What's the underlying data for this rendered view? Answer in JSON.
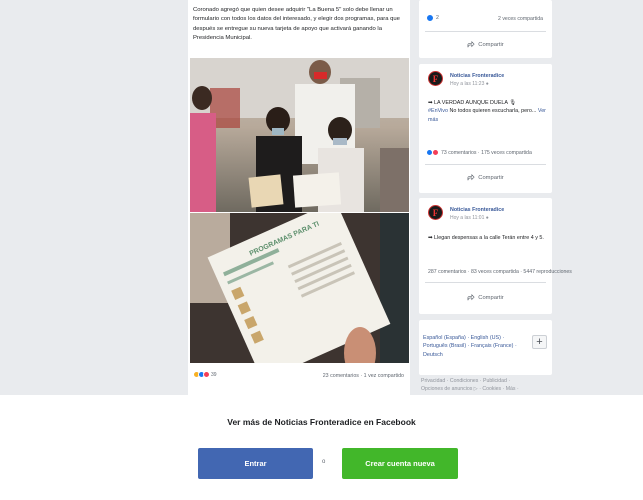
{
  "post": {
    "text": "Coronado agregó que quien desee adquirir \"La Buena 5\" solo debe llenar un formulario con todos los datos del interesado, y elegir dos programas, para que después se entregue su nueva tarjeta de apoyo que activará ganando la Presidencia Municipal.",
    "reaction_count": "39",
    "counts": "23 comentarios · 1 vez compartido",
    "photo2_caption": "PROGRAMAS PARA TI",
    "reaction_colors": [
      "#f7b125",
      "#1877f2",
      "#f33e58"
    ]
  },
  "sidebar": {
    "card0": {
      "reaction_count": "2",
      "shares": "2 veces compartida",
      "share_label": "Compartir"
    },
    "card1": {
      "page_name": "Noticias Fronteradice",
      "time": "Hoy a las 11:23",
      "snippet_line1": "➡ LA VERDAD AUNQUE DUELA 🎙",
      "hashtag": "#EnVivo",
      "snippet_rest": " No todos quieren escucharla, pero...",
      "see_more": "Ver más",
      "stats": "73 comentarios · 175 veces compartida",
      "share_label": "Compartir"
    },
    "card2": {
      "page_name": "Noticias Fronteradice",
      "time": "Hoy a las 11:01",
      "snippet": "➡ Llegan despensas a la calle Terán entre 4 y 5.",
      "stats": "287 comentarios · 83 veces compartida · 5447 reproducciones",
      "share_label": "Compartir"
    },
    "languages": {
      "line1": "Español (España) · English (US) ·",
      "line2": "Português (Brasil) · Français (France) ·",
      "line3": "Deutsch",
      "plus": "+"
    },
    "footer": {
      "line1": "Privacidad · Condiciones · Publicidad ·",
      "line2": "Opciones de anuncios ▷ · Cookies · Más ·"
    }
  },
  "banner": {
    "title": "Ver más de Noticias Fronteradice en Facebook",
    "enter_label": "Entrar",
    "or_label": "o",
    "create_label": "Crear cuenta nueva"
  },
  "colors": {
    "facebook_blue": "#4267b2",
    "create_green": "#42b72a",
    "link_blue": "#385898"
  }
}
